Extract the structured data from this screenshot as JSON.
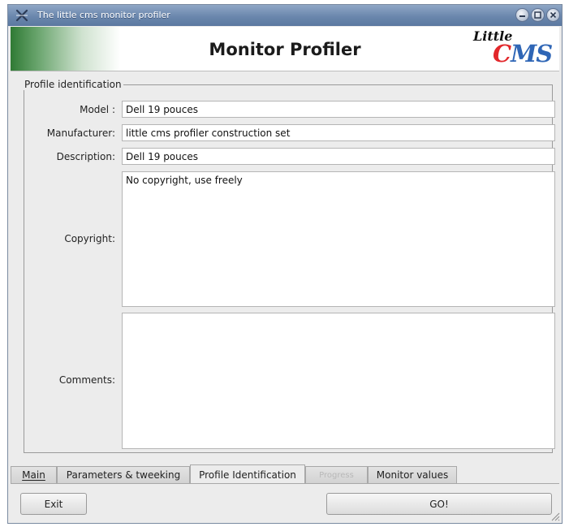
{
  "window": {
    "title": "The little cms monitor profiler"
  },
  "header": {
    "title": "Monitor Profiler",
    "logo": {
      "little": "Little",
      "cms_c": "C",
      "cms_ms": "MS"
    }
  },
  "group": {
    "legend": "Profile identification",
    "fields": {
      "model": {
        "label": "Model :",
        "value": "Dell 19 pouces"
      },
      "manufacturer": {
        "label": "Manufacturer:",
        "value": "little cms profiler construction set"
      },
      "description": {
        "label": "Description:",
        "value": "Dell 19 pouces"
      },
      "copyright": {
        "label": "Copyright:",
        "value": "No copyright, use freely"
      },
      "comments": {
        "label": "Comments:",
        "value": ""
      }
    }
  },
  "tabs": {
    "main": "Main",
    "parameters": "Parameters & tweeking",
    "profile_identification": "Profile Identification",
    "progress": "Progress",
    "monitor_values": "Monitor values"
  },
  "buttons": {
    "exit": "Exit",
    "go": "GO!"
  },
  "colors": {
    "titlebar": "#6b87ad",
    "logo_c": "#e2272b",
    "logo_ms": "#2f66b6",
    "header_green": "#2f7a34"
  }
}
